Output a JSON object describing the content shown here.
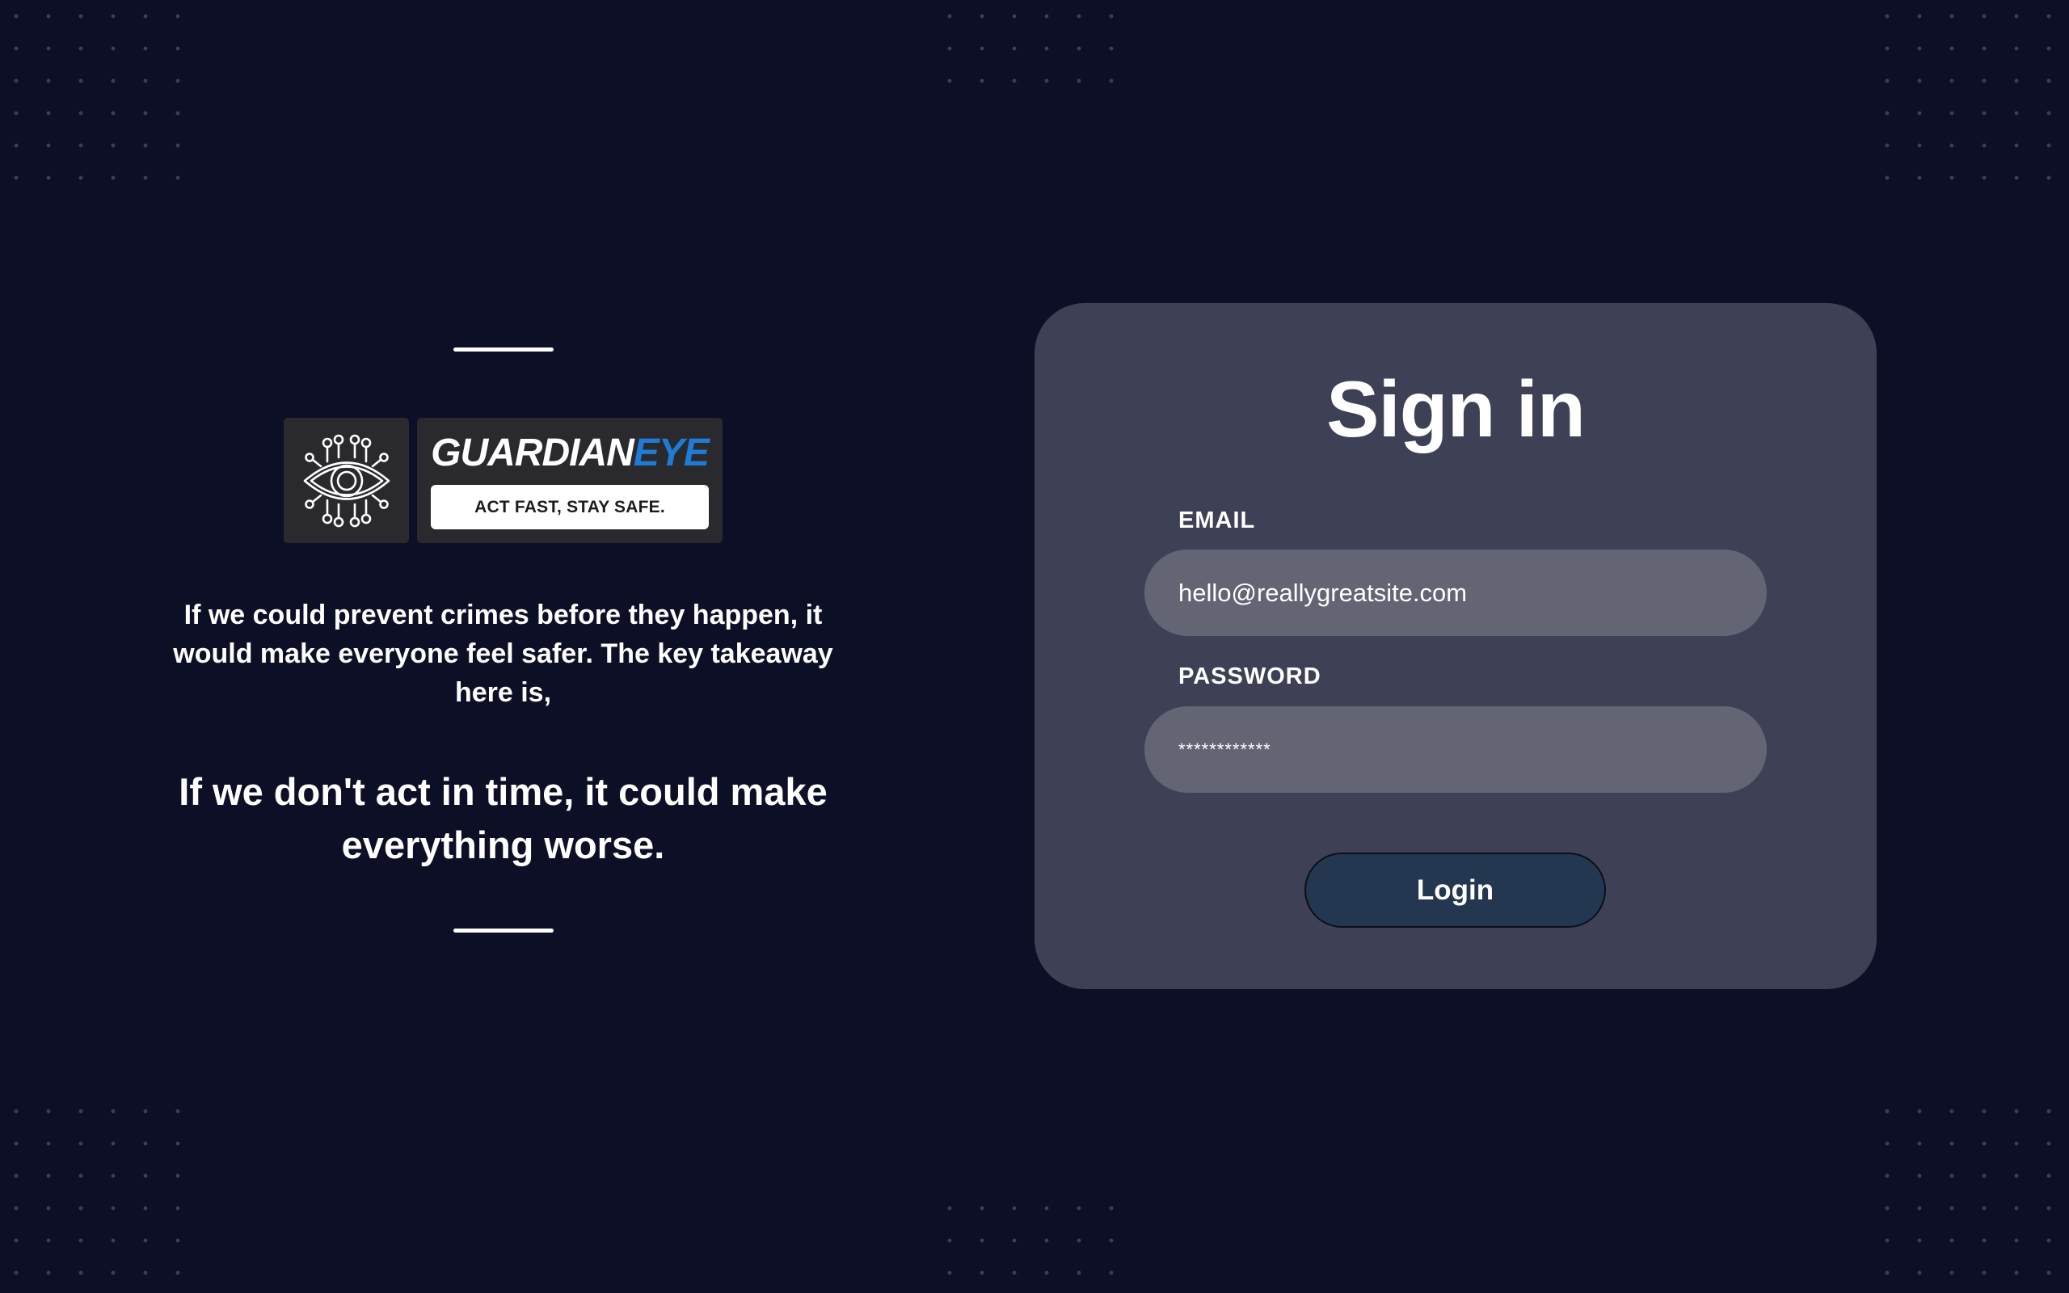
{
  "brand": {
    "name_part1": "GUARDIAN",
    "name_part2": "EYE",
    "tagline": "ACT FAST, STAY SAFE.",
    "accent_color": "#1e7bd6",
    "icon": "circuit-eye-icon"
  },
  "left": {
    "intro": "If we could prevent crimes before they happen, it would make everyone feel safer. The key takeaway here is,",
    "emphasis": "If we don't act in time, it could make everything worse."
  },
  "signin": {
    "title": "Sign in",
    "email_label": "EMAIL",
    "email_value": "hello@reallygreatsite.com",
    "password_label": "PASSWORD",
    "password_value": "************",
    "login_label": "Login"
  },
  "colors": {
    "background": "#0d0f27",
    "card": "#3e4155",
    "field": "#636575",
    "button": "#233850"
  }
}
